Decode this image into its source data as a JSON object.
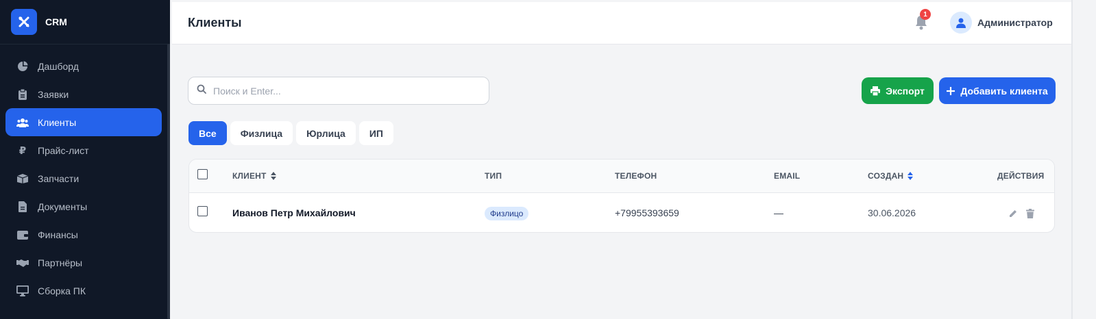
{
  "app": {
    "name": "CRM"
  },
  "sidebar": {
    "items": [
      {
        "label": "Дашборд",
        "icon": "chart-pie-icon",
        "active": false
      },
      {
        "label": "Заявки",
        "icon": "clipboard-icon",
        "active": false
      },
      {
        "label": "Клиенты",
        "icon": "users-icon",
        "active": true
      },
      {
        "label": "Прайс-лист",
        "icon": "ruble-icon",
        "active": false
      },
      {
        "label": "Запчасти",
        "icon": "box-icon",
        "active": false
      },
      {
        "label": "Документы",
        "icon": "file-icon",
        "active": false
      },
      {
        "label": "Финансы",
        "icon": "wallet-icon",
        "active": false
      },
      {
        "label": "Партнёры",
        "icon": "handshake-icon",
        "active": false
      },
      {
        "label": "Сборка ПК",
        "icon": "desktop-icon",
        "active": false
      }
    ]
  },
  "header": {
    "title": "Клиенты",
    "notifications_count": "1",
    "user_name": "Администратор"
  },
  "toolbar": {
    "search_placeholder": "Поиск и Enter...",
    "export_label": "Экспорт",
    "add_label": "Добавить клиента"
  },
  "filters": {
    "tabs": [
      {
        "label": "Все",
        "active": true
      },
      {
        "label": "Физлица",
        "active": false
      },
      {
        "label": "Юрлица",
        "active": false
      },
      {
        "label": "ИП",
        "active": false
      }
    ]
  },
  "table": {
    "columns": [
      "КЛИЕНТ",
      "ТИП",
      "ТЕЛЕФОН",
      "EMAIL",
      "СОЗДАН",
      "ДЕЙСТВИЯ"
    ],
    "rows": [
      {
        "client": "Иванов Петр Михайлович",
        "type": "Физлицо",
        "phone": "+79955393659",
        "email": "—",
        "created": "30.06.2026"
      }
    ]
  },
  "colors": {
    "sidebar_bg": "#101827",
    "accent": "#2563eb",
    "export_green": "#16a34a",
    "badge_red": "#ef4444"
  }
}
